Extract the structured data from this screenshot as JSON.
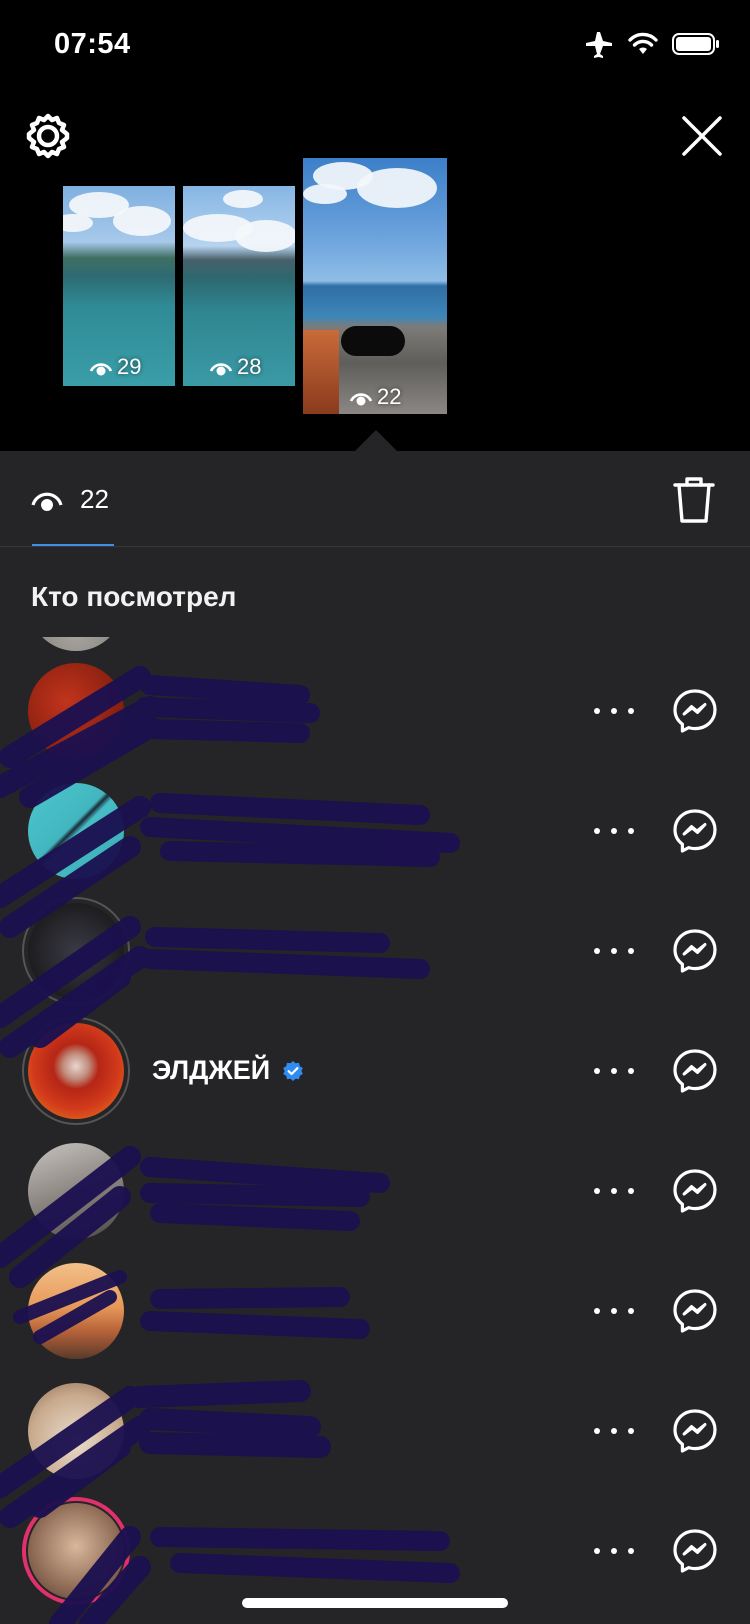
{
  "status_bar": {
    "time": "07:54",
    "icons": [
      "airplane-icon",
      "wifi-icon",
      "battery-icon"
    ]
  },
  "header": {
    "settings_icon": "gear-icon",
    "close_icon": "close-icon"
  },
  "stories": [
    {
      "views": "29"
    },
    {
      "views": "28"
    },
    {
      "views": "22",
      "selected": true
    }
  ],
  "stats": {
    "views": "22",
    "delete_icon": "trash-icon"
  },
  "viewers_section": {
    "title": "Кто посмотрел",
    "viewers": [
      {
        "name": "",
        "redacted": true
      },
      {
        "name": "",
        "redacted": true
      },
      {
        "name": "",
        "redacted": true
      },
      {
        "name": "",
        "redacted": true
      },
      {
        "name": "ЭЛДЖЕЙ",
        "verified": true
      },
      {
        "name": "",
        "redacted": true
      },
      {
        "name": "",
        "redacted": true
      },
      {
        "name": "",
        "redacted": true
      },
      {
        "name": "",
        "redacted": true
      }
    ]
  },
  "colors": {
    "sheet_bg": "#252427",
    "accent": "#3f8fe8",
    "verified": "#2f8cf0",
    "scribble": "#1b1050"
  }
}
